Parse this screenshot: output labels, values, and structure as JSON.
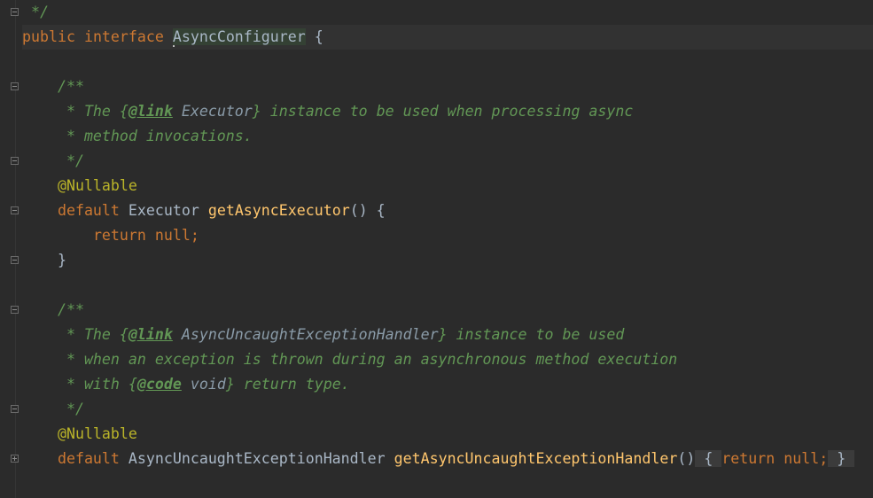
{
  "lines": {
    "l0": {
      "text": " */"
    },
    "l1": {
      "kw1": "public",
      "kw2": "interface",
      "name": "AsyncConfigurer",
      "brace": "{"
    },
    "l3": {
      "text": "/**"
    },
    "l4": {
      "pre": " * The {",
      "tag": "@link",
      "ref": "Executor",
      "post": "} instance to be used when processing async"
    },
    "l5": {
      "text": " * method invocations."
    },
    "l6": {
      "text": " */"
    },
    "l7": {
      "text": "@Nullable"
    },
    "l8": {
      "kw": "default",
      "type": "Executor",
      "fn": "getAsyncExecutor",
      "rest": "() {"
    },
    "l9": {
      "kw": "return null;"
    },
    "l10": {
      "text": "}"
    },
    "l12": {
      "text": "/**"
    },
    "l13": {
      "pre": " * The {",
      "tag": "@link",
      "ref": "AsyncUncaughtExceptionHandler",
      "post": "} instance to be used"
    },
    "l14": {
      "text": " * when an exception is thrown during an asynchronous method execution"
    },
    "l15": {
      "pre": " * with {",
      "tag": "@code",
      "ref": "void",
      "post": "} return type."
    },
    "l16": {
      "text": " */"
    },
    "l17": {
      "text": "@Nullable"
    },
    "l18": {
      "kw": "default",
      "type": "AsyncUncaughtExceptionHandler",
      "fn": "getAsyncUncaughtExceptionHandler",
      "paren": "()",
      "ob": "{",
      "body": "return null;",
      "cb": "}"
    }
  }
}
